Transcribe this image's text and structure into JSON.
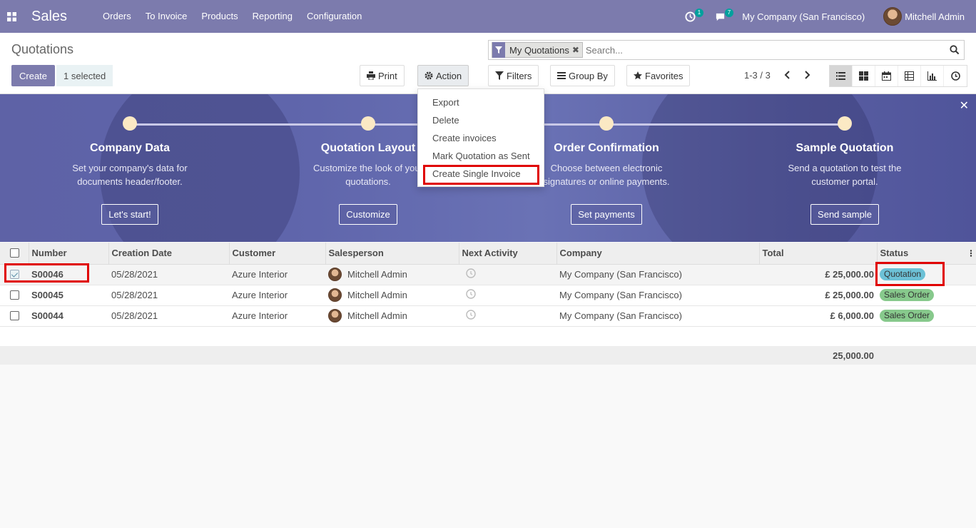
{
  "navbar": {
    "brand": "Sales",
    "menu": [
      "Orders",
      "To Invoice",
      "Products",
      "Reporting",
      "Configuration"
    ],
    "activity_count": "1",
    "message_count": "7",
    "company": "My Company (San Francisco)",
    "user": "Mitchell Admin"
  },
  "control": {
    "breadcrumb": "Quotations",
    "create_label": "Create",
    "selected_label": "1 selected",
    "print_label": "Print",
    "action_label": "Action",
    "filters_label": "Filters",
    "groupby_label": "Group By",
    "favorites_label": "Favorites",
    "facet_label": "My Quotations",
    "search_placeholder": "Search...",
    "pager": "1-3 / 3"
  },
  "action_menu": [
    "Export",
    "Delete",
    "Create invoices",
    "Mark Quotation as Sent",
    "Create Single Invoice"
  ],
  "banner": {
    "steps": [
      {
        "title": "Company Data",
        "desc1": "Set your company's data for",
        "desc2": "documents header/footer.",
        "button": "Let's start!"
      },
      {
        "title": "Quotation Layout",
        "desc1": "Customize the look of your",
        "desc2": "quotations.",
        "button": "Customize"
      },
      {
        "title": "Order Confirmation",
        "desc1": "Choose between electronic",
        "desc2": "signatures or online payments.",
        "button": "Set payments"
      },
      {
        "title": "Sample Quotation",
        "desc1": "Send a quotation to test the",
        "desc2": "customer portal.",
        "button": "Send sample"
      }
    ]
  },
  "table": {
    "headers": [
      "Number",
      "Creation Date",
      "Customer",
      "Salesperson",
      "Next Activity",
      "Company",
      "Total",
      "Status"
    ],
    "rows": [
      {
        "number": "S00046",
        "date": "05/28/2021",
        "customer": "Azure Interior",
        "salesperson": "Mitchell Admin",
        "company": "My Company (San Francisco)",
        "total": "£ 25,000.00",
        "status": "Quotation"
      },
      {
        "number": "S00045",
        "date": "05/28/2021",
        "customer": "Azure Interior",
        "salesperson": "Mitchell Admin",
        "company": "My Company (San Francisco)",
        "total": "£ 25,000.00",
        "status": "Sales Order"
      },
      {
        "number": "S00044",
        "date": "05/28/2021",
        "customer": "Azure Interior",
        "salesperson": "Mitchell Admin",
        "company": "My Company (San Francisco)",
        "total": "£ 6,000.00",
        "status": "Sales Order"
      }
    ],
    "footer_total": "25,000.00"
  },
  "colors": {
    "brand": "#7c7bad",
    "highlight": "#e00000",
    "quotation_badge": "#6cc1d6",
    "sales_order_badge": "#87c98c"
  }
}
